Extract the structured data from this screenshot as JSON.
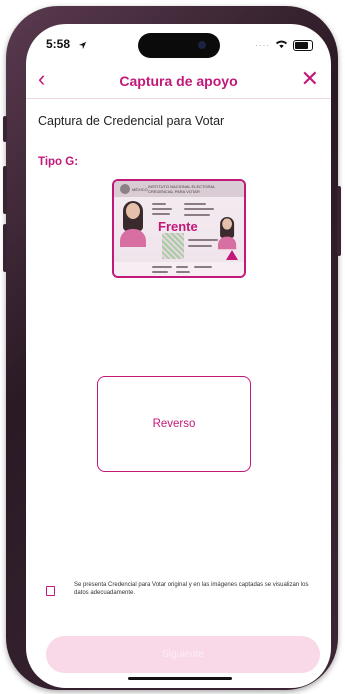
{
  "status_bar": {
    "time": "5:58",
    "location_icon": "location-arrow-icon",
    "signal_icon": "dots-signal-icon",
    "wifi_icon": "wifi-icon",
    "battery_icon": "battery-icon"
  },
  "nav": {
    "title": "Captura de apoyo",
    "back_glyph": "‹",
    "close_glyph": "✕"
  },
  "subtitle": "Captura de Credencial para Votar",
  "tipo_label": "Tipo G:",
  "card": {
    "header_line1": "INSTITUTO NACIONAL ELECTORAL",
    "header_line2": "CREDENCIAL PARA VOTAR",
    "country": "MÉXICO",
    "face_label": "Frente"
  },
  "reverso_label": "Reverso",
  "consent_text": "Se presenta Credencial para Votar original y en las imágenes captadas se visualizan los datos adecuadamente.",
  "next_button_label": "Siguiente",
  "colors": {
    "accent": "#c2187a",
    "button_disabled_bg": "#f9d9e8",
    "frame": "#3d2636"
  }
}
